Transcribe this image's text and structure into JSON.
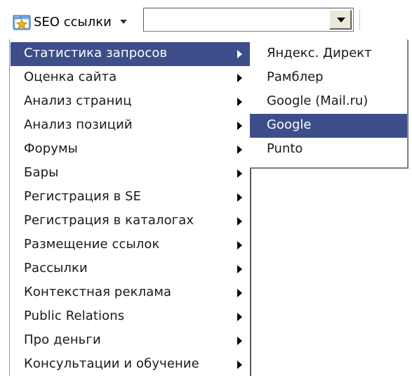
{
  "toolbar": {
    "button_label": "SEO ссылки",
    "icon": "folder-star-icon",
    "combo_value": ""
  },
  "menu": {
    "items": [
      {
        "label": "Статистика запросов"
      },
      {
        "label": "Оценка сайта"
      },
      {
        "label": "Анализ страниц"
      },
      {
        "label": "Анализ позиций"
      },
      {
        "label": "Форумы"
      },
      {
        "label": "Бары"
      },
      {
        "label": "Регистрация в SE"
      },
      {
        "label": "Регистрация в каталогах"
      },
      {
        "label": "Размещение ссылок"
      },
      {
        "label": "Рассылки"
      },
      {
        "label": "Контекстная реклама"
      },
      {
        "label": "Public Relations"
      },
      {
        "label": "Про деньги"
      },
      {
        "label": "Консультации и обучение"
      }
    ],
    "active_index": 0
  },
  "submenu": {
    "items": [
      {
        "label": "Яндекс. Директ"
      },
      {
        "label": "Рамблер"
      },
      {
        "label": "Google (Mail.ru)"
      },
      {
        "label": "Google"
      },
      {
        "label": "Punto"
      }
    ],
    "active_index": 3
  },
  "colors": {
    "highlight": "#3d4e8a",
    "highlight_text": "#ffffff",
    "text": "#1a1a1a"
  }
}
